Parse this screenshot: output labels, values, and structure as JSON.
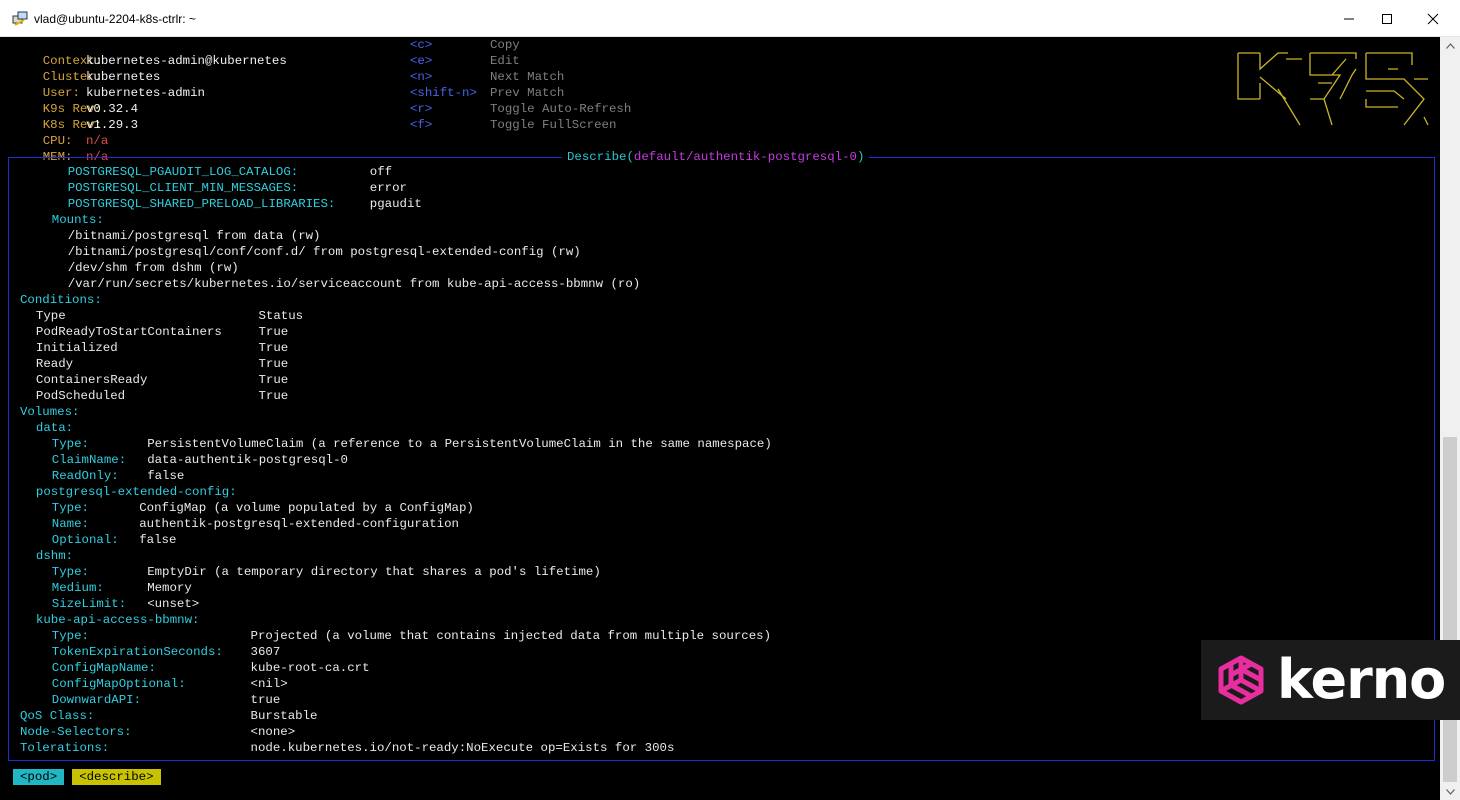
{
  "window": {
    "title": "vlad@ubuntu-2204-k8s-ctrlr: ~",
    "icons": [
      "putty-icon",
      "minimize-icon",
      "maximize-icon",
      "close-icon"
    ]
  },
  "header": {
    "context_label": "Context:",
    "context_value": "kubernetes-admin@kubernetes",
    "cluster_label": "Cluster:",
    "cluster_value": "kubernetes",
    "user_label": "User:",
    "user_value": "kubernetes-admin",
    "k9s_rev_label": "K9s Rev:",
    "k9s_rev_value": "v0.32.4",
    "k8s_rev_label": "K8s Rev:",
    "k8s_rev_value": "v1.29.3",
    "cpu_label": "CPU:",
    "cpu_value": "n/a",
    "mem_label": "MEM:",
    "mem_value": "n/a"
  },
  "keybindings": [
    {
      "key": "<c>",
      "action": "Copy"
    },
    {
      "key": "<e>",
      "action": "Edit"
    },
    {
      "key": "<n>",
      "action": "Next Match"
    },
    {
      "key": "<shift-n>",
      "action": "Prev Match"
    },
    {
      "key": "<r>",
      "action": "Toggle Auto-Refresh"
    },
    {
      "key": "<f>",
      "action": "Toggle FullScreen"
    }
  ],
  "describe": {
    "title_prefix": "Describe(",
    "title_path": "default/authentik-postgresql-0",
    "title_suffix": ")",
    "lines": [
      {
        "k": "POSTGRESQL_PGAUDIT_LOG_CATALOG:",
        "v": "off"
      },
      {
        "k": "POSTGRESQL_CLIENT_MIN_MESSAGES:",
        "v": "error"
      },
      {
        "k": "POSTGRESQL_SHARED_PRELOAD_LIBRARIES:",
        "v": "pgaudit"
      },
      {
        "k": "Mounts:",
        "v": ""
      },
      {
        "k": "",
        "v": "/bitnami/postgresql from data (rw)"
      },
      {
        "k": "",
        "v": "/bitnami/postgresql/conf/conf.d/ from postgresql-extended-config (rw)"
      },
      {
        "k": "",
        "v": "/dev/shm from dshm (rw)"
      },
      {
        "k": "",
        "v": "/var/run/secrets/kubernetes.io/serviceaccount from kube-api-access-bbmnw (ro)"
      },
      {
        "k": "Conditions:",
        "v": ""
      },
      {
        "k": "",
        "v": "Type",
        "v2": "Status"
      },
      {
        "k": "",
        "v": "PodReadyToStartContainers",
        "v2": "True"
      },
      {
        "k": "",
        "v": "Initialized",
        "v2": "True"
      },
      {
        "k": "",
        "v": "Ready",
        "v2": "True"
      },
      {
        "k": "",
        "v": "ContainersReady",
        "v2": "True"
      },
      {
        "k": "",
        "v": "PodScheduled",
        "v2": "True"
      },
      {
        "k": "Volumes:",
        "v": ""
      },
      {
        "k": "data:",
        "v": ""
      },
      {
        "k": "Type:",
        "v": "PersistentVolumeClaim (a reference to a PersistentVolumeClaim in the same namespace)"
      },
      {
        "k": "ClaimName:",
        "v": "data-authentik-postgresql-0"
      },
      {
        "k": "ReadOnly:",
        "v": "false"
      },
      {
        "k": "postgresql-extended-config:",
        "v": ""
      },
      {
        "k": "Type:",
        "v": "ConfigMap (a volume populated by a ConfigMap)"
      },
      {
        "k": "Name:",
        "v": "authentik-postgresql-extended-configuration"
      },
      {
        "k": "Optional:",
        "v": "false"
      },
      {
        "k": "dshm:",
        "v": ""
      },
      {
        "k": "Type:",
        "v": "EmptyDir (a temporary directory that shares a pod's lifetime)"
      },
      {
        "k": "Medium:",
        "v": "Memory"
      },
      {
        "k": "SizeLimit:",
        "v": "<unset>"
      },
      {
        "k": "kube-api-access-bbmnw:",
        "v": ""
      },
      {
        "k": "Type:",
        "v": "Projected (a volume that contains injected data from multiple sources)"
      },
      {
        "k": "TokenExpirationSeconds:",
        "v": "3607"
      },
      {
        "k": "ConfigMapName:",
        "v": "kube-root-ca.crt"
      },
      {
        "k": "ConfigMapOptional:",
        "v": "<nil>"
      },
      {
        "k": "DownwardAPI:",
        "v": "true"
      },
      {
        "k": "QoS Class:",
        "v": "Burstable"
      },
      {
        "k": "Node-Selectors:",
        "v": "<none>"
      },
      {
        "k": "Tolerations:",
        "v": "node.kubernetes.io/not-ready:NoExecute op=Exists for 300s"
      }
    ]
  },
  "breadcrumbs": [
    "<pod>",
    "<describe>"
  ],
  "watermark": {
    "brand": "kerno",
    "icon": "kerno-logo-icon",
    "color": "#e62e9e"
  },
  "colors": {
    "cyan": "#2ecfe0",
    "magenta": "#c43be0",
    "border": "#1c2fd6",
    "orange": "#d6a33a",
    "red": "#e04a4a"
  }
}
